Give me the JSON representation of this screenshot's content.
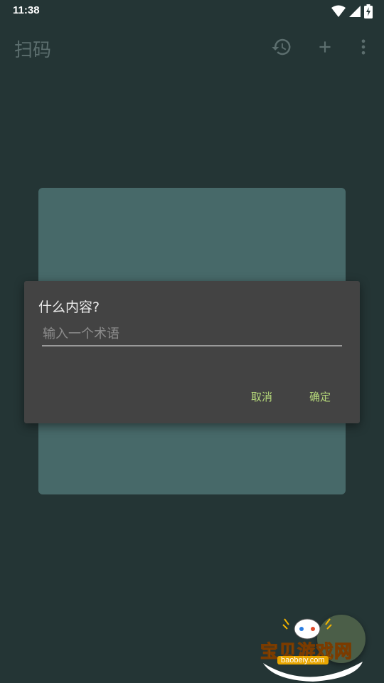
{
  "status_bar": {
    "time": "11:38",
    "icons": [
      "wifi-icon",
      "signal-icon",
      "battery-charging-icon"
    ]
  },
  "app_bar": {
    "title": "扫码",
    "actions": [
      "history-icon",
      "add-icon",
      "more-vert-icon"
    ]
  },
  "dialog": {
    "title": "什么内容?",
    "input_value": "",
    "input_placeholder": "输入一个术语",
    "cancel_label": "取消",
    "confirm_label": "确定"
  },
  "watermark": {
    "text": "宝贝游戏网",
    "url": "baobeiy.com"
  },
  "colors": {
    "background": "#243535",
    "card": "#476969",
    "dialog": "#434343",
    "accent": "#b6d97a"
  }
}
